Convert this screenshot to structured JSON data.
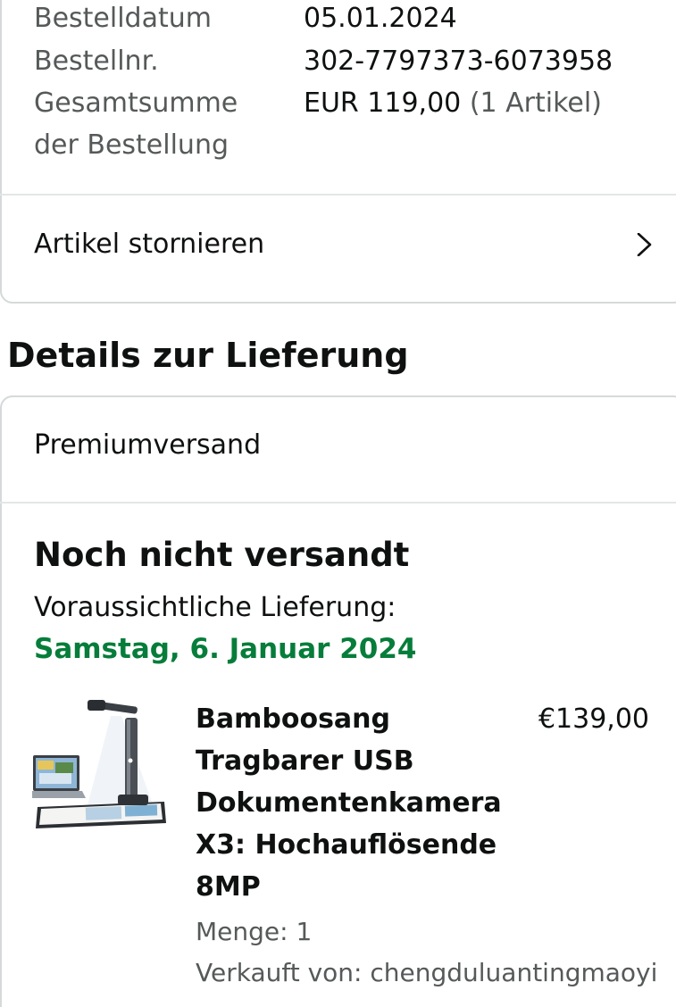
{
  "order_summary": {
    "order_date_label": "Bestelldatum",
    "order_date": "05.01.2024",
    "order_number_label": "Bestellnr.",
    "order_number": "302-7797373-6073958",
    "total_label_line1": "Gesamtsumme",
    "total_label_line2": "der Bestellung",
    "total_value": "EUR 119,00",
    "total_items": "(1 Artikel)"
  },
  "cancel_items_label": "Artikel stornieren",
  "delivery_section_title": "Details zur Lieferung",
  "delivery": {
    "shipping_method": "Premiumversand",
    "status": "Noch nicht versandt",
    "eta_label": "Voraussichtliche Lieferung:",
    "eta_date": "Samstag, 6. Januar 2024",
    "eta_color": "#067d3a"
  },
  "product": {
    "title": "Bamboosang Tragbarer USB Dokumentenkamera X3: Hochauflösende 8MP",
    "price": "€139,00",
    "quantity": "Menge: 1",
    "seller": "Verkauft von: chengduluantingmaoyi",
    "image_icon": "document-camera-product-image"
  },
  "icons": {
    "chevron": "chevron-right-icon"
  }
}
